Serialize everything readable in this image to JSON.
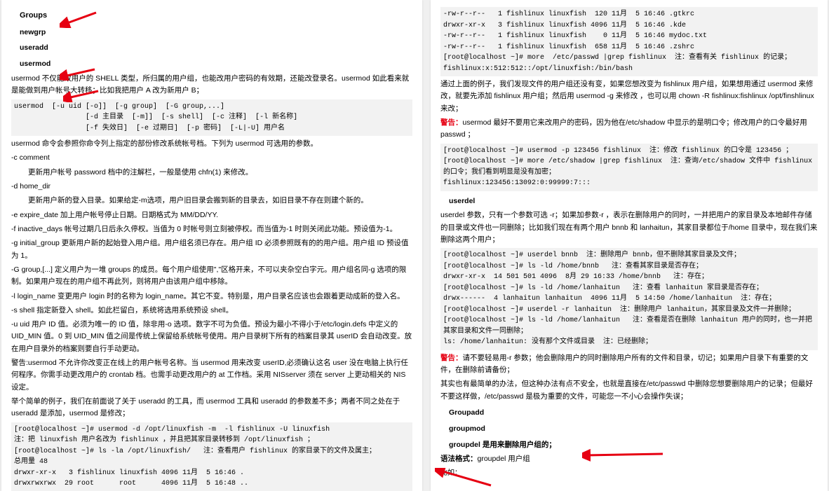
{
  "left": {
    "h1": "Groups",
    "h2": "newgrp",
    "h3": "useradd",
    "h4": "usermod",
    "p1": "usermod 不仅能改用户的 SHELL 类型，所归属的用户组，也能改用户密码的有效期，还能改登录名。usermod 如此看来就是能做到用户帐号大转移；比如我把用户 A 改为新用户 B；",
    "code1": "usermod  [-u uid [-o]]  [-g group]  [-G group,...]\n                 [-d 主目录  [-m]]  [-s shell]  [-c 注释]  [-l 新名称]\n                 [-f 失效日]  [-e 过期日]  [-p 密码]  [-L|-U] 用户名",
    "p2": "usermod 命令会参照你命令列上指定的部份修改系统帐号档。下列为 usermod 可选用的参数。",
    "opt_c": "-c comment",
    "opt_c_desc": "更新用户帐号 password 档中的注解栏，一般是使用 chfn(1) 来修改。",
    "opt_d": "-d home_dir",
    "opt_d_desc": "更新用户新的登入目录。如果给定-m选项，用户旧目录会搬到新的目录去，如旧目录不存在则建个新的。",
    "opt_e": "-e expire_date 加上用户帐号停止日期。日期格式为 MM/DD/YY.",
    "opt_f": "-f inactive_days 帐号过期几日后永久停权。当值为 0 时帐号则立刻被停权。而当值为-1 时则关闭此功能。预设值为-1。",
    "opt_g": "-g initial_group 更新用户新的起始登入用户组。用户组名须已存在。用户组 ID 必须参照既有的的用户组。用户组 ID 预设值为 1。",
    "opt_G": "-G group,[...] 定义用户为一堆 groups 的成员。每个用户组使用\",\"区格开来，不可以夹杂空白字元。用户组名同-g 选项的限制。如果用户现在的用户组不再此列，则将用户由该用户组中移除。",
    "opt_l": "-l login_name  变更用户 login 时的名称为 login_name。其它不变。特别是，用户目录名应该也会跟着更动成新的登入名。",
    "opt_s": "-s shell  指定新登入 shell。如此栏留白，系统将选用系统预设 shell。",
    "opt_u": "-u uid 用户 ID 值。必须为唯一的 ID 值，除非用-o 选项。数字不可为负值。预设为最小不得小于/etc/login.defs 中定义的UID_MIN 值。0 到 UID_MIN 值之间是传统上保留给系统帐号使用。用户目录树下所有的档案目录其 userID 会自动改变。放在用户目录外的档案则要自行手动更动。",
    "warn1": "警告:usermod 不允许你改变正在线上的用户帐号名称。当 usermod 用来改变 userID,必须确认这名 user 没在电脑上执行任何程序。你需手动更改用户的 crontab 档。也需手动更改用户的 at 工作档。采用 NISserver 须在 server 上更动相关的 NIS 设定。",
    "p3": "举个简单的例子，我们在前面说了关于 useradd 的工具，而 usermod 工具和 useradd 的参数差不多；两者不同之处在于 useradd 是添加，usermod 是修改；",
    "code2": "[root@localhost ~]# usermod -d /opt/linuxfish -m  -l fishlinux -U linuxfish\n注：把 linuxfish 用户名改为 fishlinux ，并且把其家目录转移到 /opt/linuxfish ；\n[root@localhost ~]# ls -la /opt/linuxfish/   注：查看用户 fishlinux 的家目录下的文件及属主；\n总用量 48\ndrwxr-xr-x   3 fishlinux linuxfish 4096 11月  5 16:46 .\ndrwxrwxrwx  29 root      root      4096 11月  5 16:48 .."
  },
  "right": {
    "code1": "-rw-r--r--   1 fishlinux linuxfish  120 11月  5 16:46 .gtkrc\ndrwxr-xr-x   3 fishlinux linuxfish 4096 11月  5 16:46 .kde\n-rw-r--r--   1 fishlinux linuxfish    0 11月  5 16:46 mydoc.txt\n-rw-r--r--   1 fishlinux linuxfish  658 11月  5 16:46 .zshrc\n[root@localhost ~]# more  /etc/passwd |grep fishlinux  注：查看有关 fishlinux 的记录；\nfishlinux:x:512:512::/opt/linuxfish:/bin/bash",
    "p1": "通过上面的例子，我们发现文件的用户组还没有变，如果您想改变为 fishlinux 用户组，如果想用通过 usermod 来修改，就要先添加 fishlinux 用户组；然后用 usermod -g  来修改 ，也可以用 chown -R fishlinux:fishlinux /opt/finshlinux  来改；",
    "warn_label": "警告：",
    "warn1": "usermod 最好不要用它来改用户的密码，因为他在/etc/shadow 中显示的是明口令；修改用户的口令最好用 passwd ；",
    "code2": "[root@localhost ~]# usermod -p 123456 fishlinux  注：修改 fishlinux 的口令是 123456 ；\n[root@localhost ~]# more /etc/shadow |grep fishlinux  注：查询/etc/shadow 文件中 fishlinux 的口令；我们看到明显是没有加密；\nfishlinux:123456:13092:0:99999:7:::",
    "h_userdel": "userdel",
    "p2": "userdel  参数，只有一个参数可选 -r；如果加参数-r ，表示在删除用户的同时，一并把用户的家目录及本地邮件存储的目录或文件也一同删除；比如我们现在有两个用户 bnnb 和 lanhaitun，其家目录都位于/home 目录中，现在我们来删除这两个用户；",
    "code3": "[root@localhost ~]# userdel bnnb  注：删除用户 bnnb，但不删除其家目录及文件；\n[root@localhost ~]# ls -ld /home/bnnb   注：查看其家目录是否存在；\ndrwxr-xr-x  14 501 501 4096  8月 29 16:33 /home/bnnb   注：存在；\n[root@localhost ~]# ls -ld /home/lanhaitun   注：查看 lanhaitun 家目录是否存在；\ndrwx------  4 lanhaitun lanhaitun  4096 11月  5 14:50 /home/lanhaitun  注：存在；\n[root@localhost ~]# userdel -r lanhaitun  注：删除用户 lanhaitun，其家目录及文件一并删除；\n[root@localhost ~]# ls -ld /home/lanhaitun   注：查看是否在删除 lanhaitun 用户的同时，也一并把其家目录和文件一同删除；\nls: /home/lanhaitun: 没有那个文件或目录  注：已经删除；",
    "warn2": "请不要轻易用-r 参数；他会删除用户的同时删除用户所有的文件和目录，切记；如果用户目录下有重要的文件，在删除前请备份；",
    "p3": "其实也有最简单的办法，但这种办法有点不安全，也就是直接在/etc/passwd 中删除您想要删除用户的记录；但最好不要这样做，/etc/passwd 是极为重要的文件，可能您一不小心会操作失误；",
    "h_groupadd": "Groupadd",
    "h_groupmod": "groupmod",
    "h_groupdel": "groupdel  是用来删除用户组的；",
    "syntax_label": "语法格式：",
    "syntax": "groupdel 用户组",
    "last": "比如："
  }
}
